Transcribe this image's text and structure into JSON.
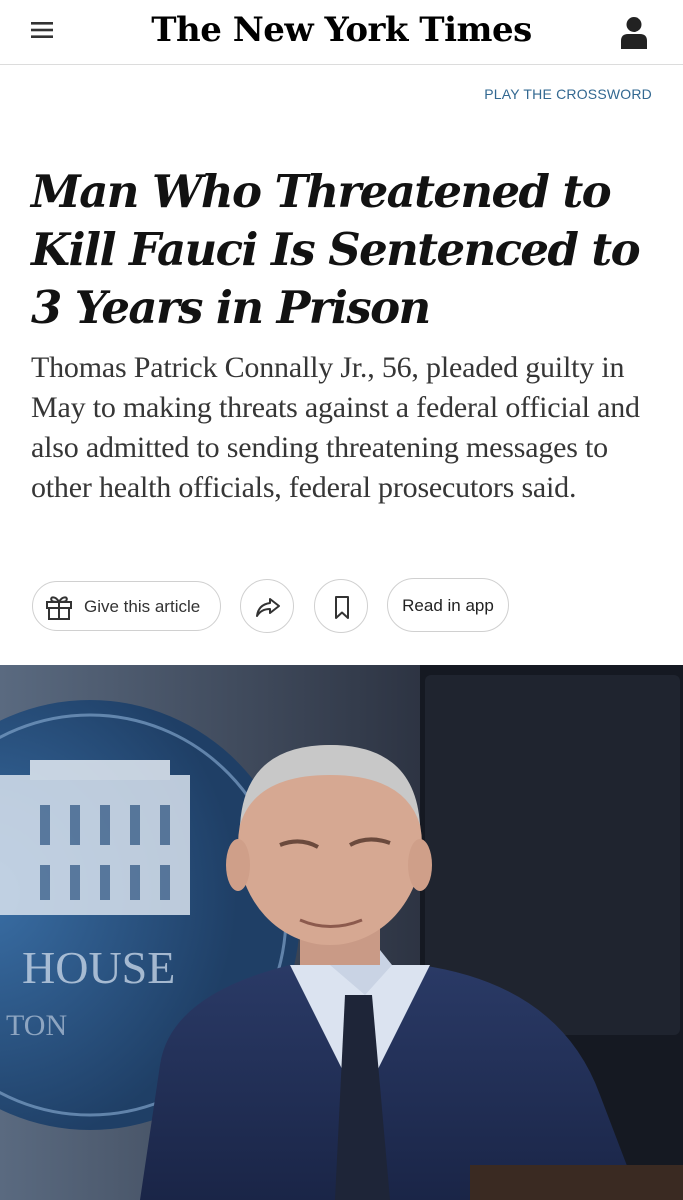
{
  "header": {
    "logo": "The New York Times",
    "menu_icon": "hamburger-menu-icon",
    "account_icon": "person-icon"
  },
  "crossword_link": "PLAY THE CROSSWORD",
  "article": {
    "headline": "Man Who Threatened to Kill Fauci Is Sentenced to 3 Years in Prison",
    "summary": "Thomas Patrick Connally Jr., 56, pleaded guilty in May to making threats against a federal official and also admitted to sending threatening messages to other health officials, federal prosecutors said."
  },
  "actions": {
    "gift_label": "Give this article",
    "gift_icon": "gift-icon",
    "share_icon": "share-arrow-icon",
    "save_icon": "bookmark-icon",
    "app_label": "Read in app"
  },
  "photo": {
    "sign_text": "HOUSE",
    "sign_text_2": "TON"
  },
  "colors": {
    "link_blue": "#326891",
    "headline": "#121212",
    "summary": "#363636",
    "border": "#d0d0d0"
  }
}
